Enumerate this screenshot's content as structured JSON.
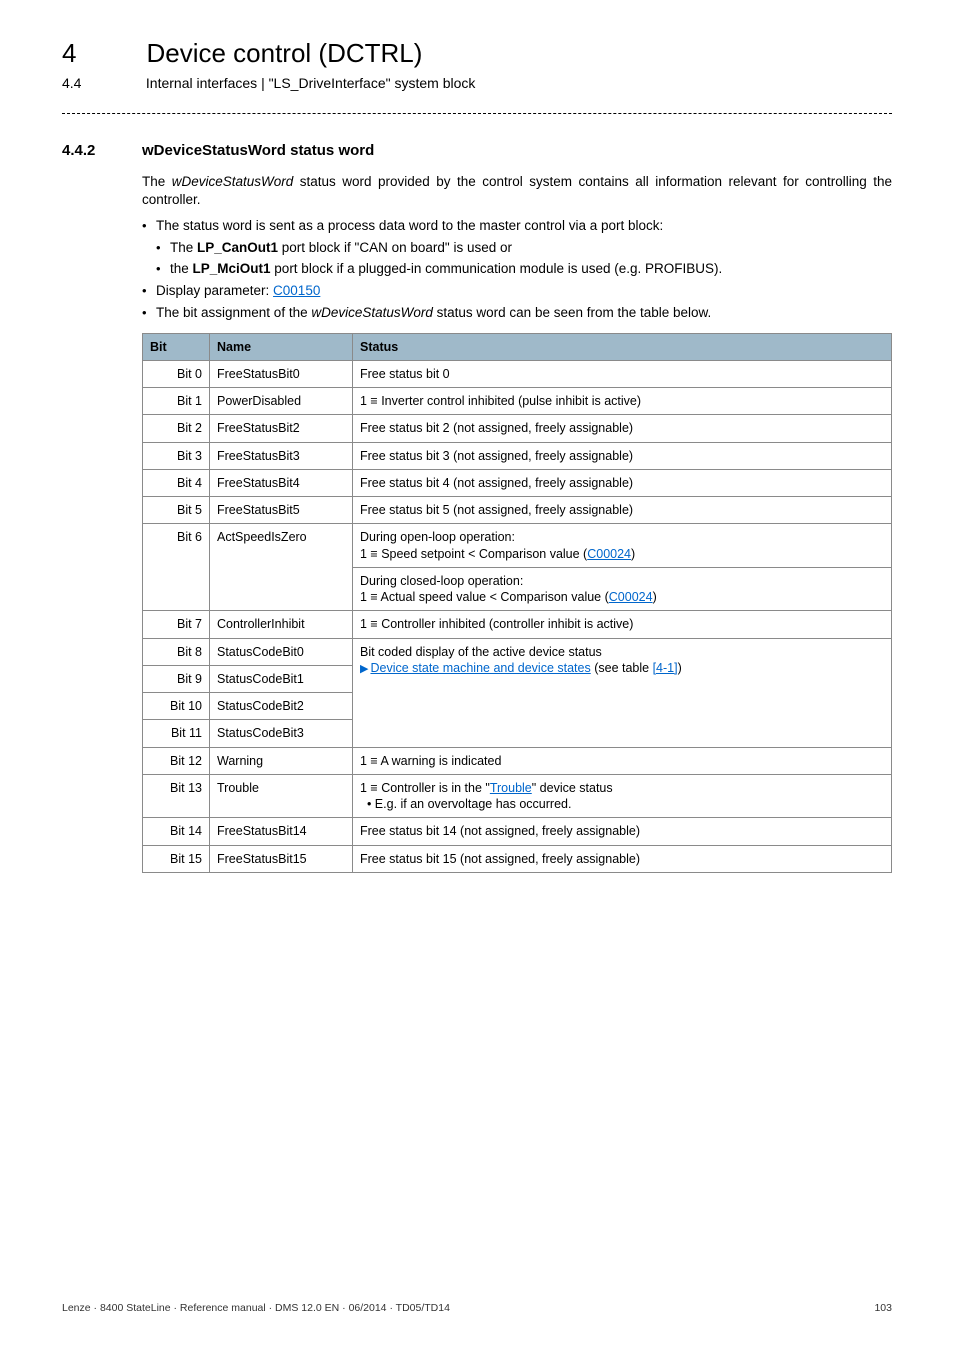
{
  "header": {
    "chapter_num": "4",
    "chapter_title": "Device control (DCTRL)",
    "sub_num": "4.4",
    "sub_title": "Internal interfaces | \"LS_DriveInterface\" system block"
  },
  "section": {
    "num": "4.4.2",
    "title": "wDeviceStatusWord status word"
  },
  "intro": {
    "p1_part1": "The ",
    "p1_em": "wDeviceStatusWord",
    "p1_part2": " status word provided by the control system contains all information relevant for controlling the controller.",
    "b1": "The status word is sent as a process data word to the master control via a port block:",
    "b1a_pre": "The ",
    "b1a_bold": "LP_CanOut1",
    "b1a_post": " port block if \"CAN on board\" is used or",
    "b1b_pre": "the ",
    "b1b_bold": "LP_MciOut1",
    "b1b_post": " port block if a plugged-in communication module is used (e.g. PROFIBUS).",
    "b2_pre": "Display parameter: ",
    "b2_link": "C00150",
    "b3_pre": "The bit assignment of the ",
    "b3_em": "wDeviceStatusWord",
    "b3_post": " status word can be seen from the table below."
  },
  "table": {
    "headers": {
      "c1": "Bit",
      "c2": "Name",
      "c3": "Status"
    },
    "rows": [
      {
        "bit": "Bit 0",
        "name": "FreeStatusBit0",
        "status": "Free status bit 0"
      },
      {
        "bit": "Bit 1",
        "name": "PowerDisabled",
        "status": "1 ≡ Inverter control inhibited (pulse inhibit is active)"
      },
      {
        "bit": "Bit 2",
        "name": "FreeStatusBit2",
        "status": "Free status bit 2 (not assigned, freely assignable)"
      },
      {
        "bit": "Bit 3",
        "name": "FreeStatusBit3",
        "status": "Free status bit 3 (not assigned, freely assignable)"
      },
      {
        "bit": "Bit 4",
        "name": "FreeStatusBit4",
        "status": "Free status bit 4 (not assigned, freely assignable)"
      },
      {
        "bit": "Bit 5",
        "name": "FreeStatusBit5",
        "status": "Free status bit 5 (not assigned, freely assignable)"
      }
    ],
    "row6": {
      "bit": "Bit 6",
      "name": "ActSpeedIsZero",
      "open_l1": "During open-loop operation:",
      "open_l2_pre": "1 ≡ Speed setpoint < Comparison value (",
      "open_l2_link": "C00024",
      "open_l2_post": ")",
      "closed_l1": "During closed-loop operation:",
      "closed_l2_pre": "1 ≡ Actual speed value < Comparison value (",
      "closed_l2_link": "C00024",
      "closed_l2_post": ")"
    },
    "row7": {
      "bit": "Bit 7",
      "name": "ControllerInhibit",
      "status": "1 ≡ Controller inhibited (controller inhibit is active)"
    },
    "row8": {
      "bit": "Bit 8",
      "name": "StatusCodeBit0",
      "status": "Bit coded display of the active device status"
    },
    "row8_sub_link_pre": "",
    "row8_sub_link": "Device state machine and device states",
    "row8_sub_post": " (see table ",
    "row8_sub_link2": "[4-1]",
    "row8_sub_post2": ")",
    "row9": {
      "bit": "Bit 9",
      "name": "StatusCodeBit1"
    },
    "row10": {
      "bit": "Bit 10",
      "name": "StatusCodeBit2"
    },
    "row11": {
      "bit": "Bit 11",
      "name": "StatusCodeBit3"
    },
    "row12": {
      "bit": "Bit 12",
      "name": "Warning",
      "status": "1 ≡ A warning is indicated"
    },
    "row13": {
      "bit": "Bit 13",
      "name": "Trouble",
      "l1_pre": "1 ≡ Controller is in the \"",
      "l1_link": "Trouble",
      "l1_post": "\" device status",
      "l2": "• E.g. if an overvoltage has occurred."
    },
    "row14": {
      "bit": "Bit 14",
      "name": "FreeStatusBit14",
      "status": "Free status bit 14 (not assigned, freely assignable)"
    },
    "row15": {
      "bit": "Bit 15",
      "name": "FreeStatusBit15",
      "status": "Free status bit 15 (not assigned, freely assignable)"
    }
  },
  "footer": {
    "left": "Lenze · 8400 StateLine · Reference manual · DMS 12.0 EN · 06/2014 · TD05/TD14",
    "right": "103"
  }
}
